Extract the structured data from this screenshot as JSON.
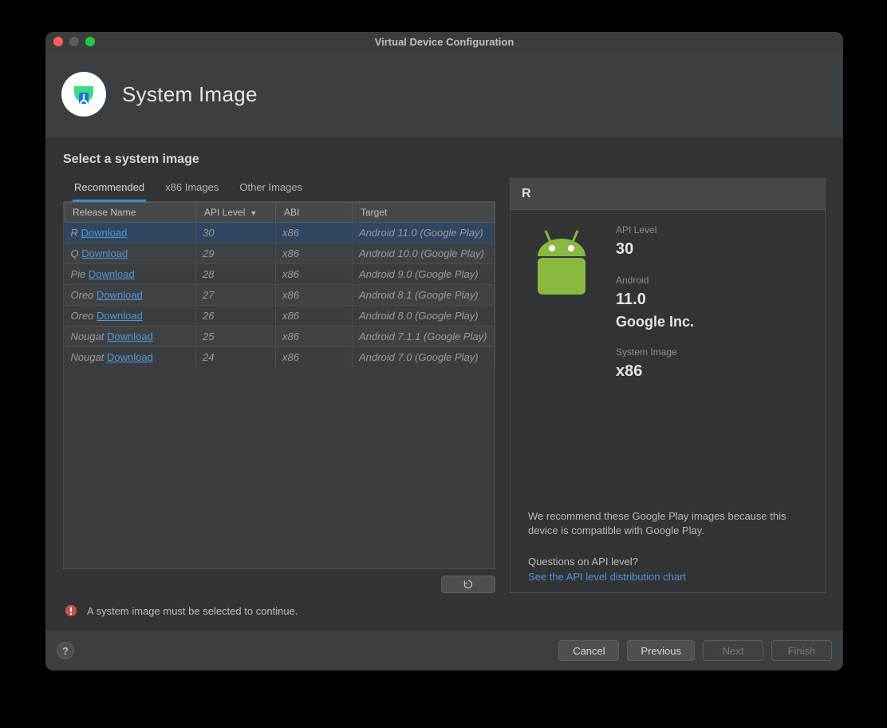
{
  "window": {
    "title": "Virtual Device Configuration"
  },
  "header": {
    "title": "System Image"
  },
  "section_title": "Select a system image",
  "tabs": [
    {
      "label": "Recommended",
      "active": true
    },
    {
      "label": "x86 Images",
      "active": false
    },
    {
      "label": "Other Images",
      "active": false
    }
  ],
  "table": {
    "columns": {
      "release_name": "Release Name",
      "api_level": "API Level",
      "abi": "ABI",
      "target": "Target"
    },
    "download_label": "Download",
    "rows": [
      {
        "release": "R",
        "api": "30",
        "abi": "x86",
        "target": "Android 11.0 (Google Play)",
        "selected": true
      },
      {
        "release": "Q",
        "api": "29",
        "abi": "x86",
        "target": "Android 10.0 (Google Play)"
      },
      {
        "release": "Pie",
        "api": "28",
        "abi": "x86",
        "target": "Android 9.0 (Google Play)"
      },
      {
        "release": "Oreo",
        "api": "27",
        "abi": "x86",
        "target": "Android 8.1 (Google Play)"
      },
      {
        "release": "Oreo",
        "api": "26",
        "abi": "x86",
        "target": "Android 8.0 (Google Play)"
      },
      {
        "release": "Nougat",
        "api": "25",
        "abi": "x86",
        "target": "Android 7.1.1 (Google Play)"
      },
      {
        "release": "Nougat",
        "api": "24",
        "abi": "x86",
        "target": "Android 7.0 (Google Play)"
      }
    ]
  },
  "detail": {
    "name": "R",
    "api_level_label": "API Level",
    "api_level": "30",
    "android_label": "Android",
    "android_version": "11.0",
    "vendor": "Google Inc.",
    "sysimg_label": "System Image",
    "sysimg": "x86",
    "recommend": "We recommend these Google Play images because this device is compatible with Google Play.",
    "question": "Questions on API level?",
    "see_the": "See the ",
    "link_text": "API level distribution chart"
  },
  "warning": "A system image must be selected to continue.",
  "footer": {
    "cancel": "Cancel",
    "previous": "Previous",
    "next": "Next",
    "finish": "Finish"
  }
}
